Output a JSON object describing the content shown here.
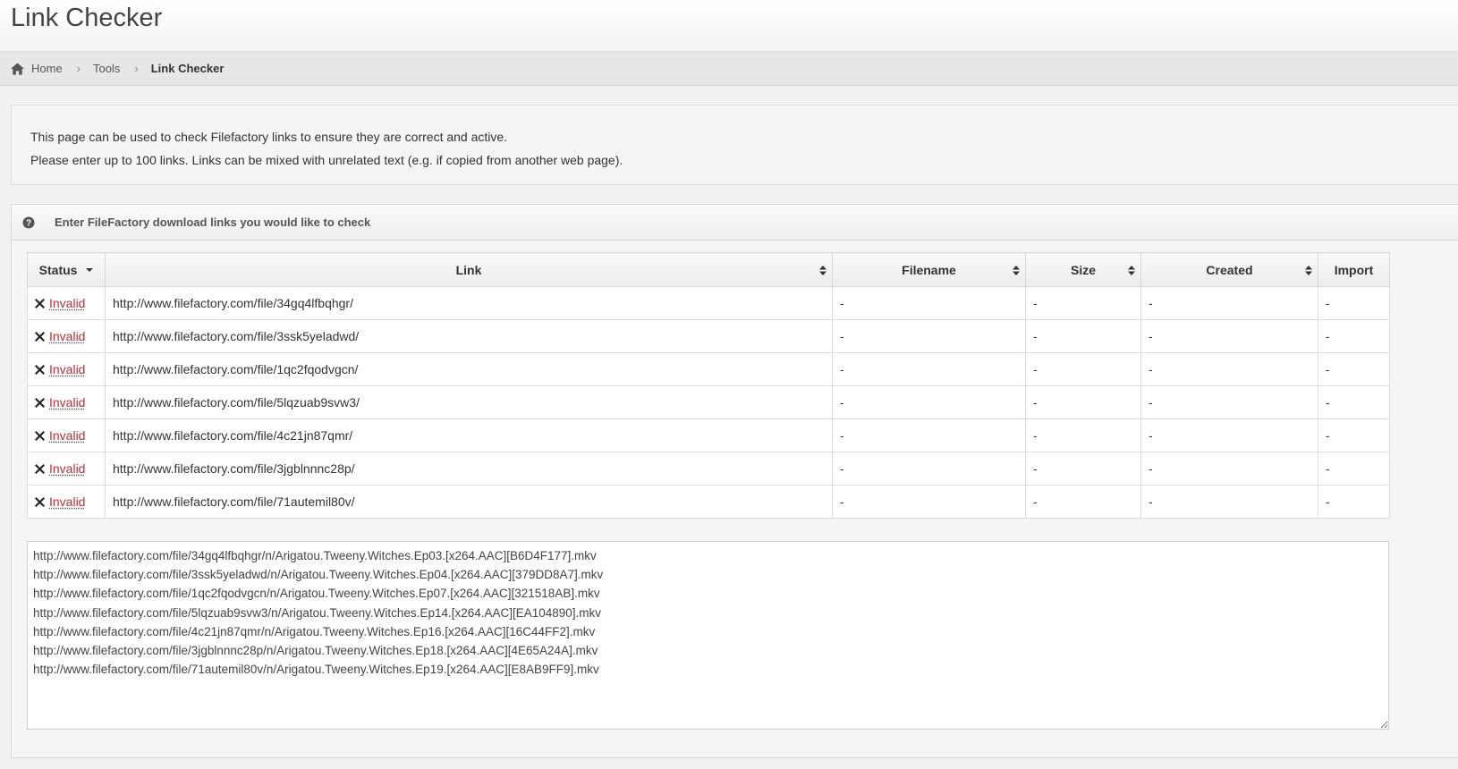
{
  "page": {
    "title": "Link Checker"
  },
  "breadcrumb": [
    {
      "label": "Home",
      "icon": "home-icon"
    },
    {
      "label": "Tools"
    },
    {
      "label": "Link Checker"
    }
  ],
  "intro": {
    "line1": "This page can be used to check Filefactory links to ensure they are correct and active.",
    "line2": "Please enter up to 100 links. Links can be mixed with unrelated text (e.g. if copied from another web page)."
  },
  "panel": {
    "title": "Enter FileFactory download links you would like to check",
    "icon": "help-circle-icon"
  },
  "table": {
    "columns": {
      "status": "Status",
      "link": "Link",
      "filename": "Filename",
      "size": "Size",
      "created": "Created",
      "import": "Import"
    },
    "rows": [
      {
        "status": "Invalid",
        "link": "http://www.filefactory.com/file/34gq4lfbqhgr/",
        "filename": "-",
        "size": "-",
        "created": "-",
        "import": "-"
      },
      {
        "status": "Invalid",
        "link": "http://www.filefactory.com/file/3ssk5yeladwd/",
        "filename": "-",
        "size": "-",
        "created": "-",
        "import": "-"
      },
      {
        "status": "Invalid",
        "link": "http://www.filefactory.com/file/1qc2fqodvgcn/",
        "filename": "-",
        "size": "-",
        "created": "-",
        "import": "-"
      },
      {
        "status": "Invalid",
        "link": "http://www.filefactory.com/file/5lqzuab9svw3/",
        "filename": "-",
        "size": "-",
        "created": "-",
        "import": "-"
      },
      {
        "status": "Invalid",
        "link": "http://www.filefactory.com/file/4c21jn87qmr/",
        "filename": "-",
        "size": "-",
        "created": "-",
        "import": "-"
      },
      {
        "status": "Invalid",
        "link": "http://www.filefactory.com/file/3jgblnnnc28p/",
        "filename": "-",
        "size": "-",
        "created": "-",
        "import": "-"
      },
      {
        "status": "Invalid",
        "link": "http://www.filefactory.com/file/71autemil80v/",
        "filename": "-",
        "size": "-",
        "created": "-",
        "import": "-"
      }
    ]
  },
  "textarea": {
    "value": "http://www.filefactory.com/file/34gq4lfbqhgr/n/Arigatou.Tweeny.Witches.Ep03.[x264.AAC][B6D4F177].mkv\nhttp://www.filefactory.com/file/3ssk5yeladwd/n/Arigatou.Tweeny.Witches.Ep04.[x264.AAC][379DD8A7].mkv\nhttp://www.filefactory.com/file/1qc2fqodvgcn/n/Arigatou.Tweeny.Witches.Ep07.[x264.AAC][321518AB].mkv\nhttp://www.filefactory.com/file/5lqzuab9svw3/n/Arigatou.Tweeny.Witches.Ep14.[x264.AAC][EA104890].mkv\nhttp://www.filefactory.com/file/4c21jn87qmr/n/Arigatou.Tweeny.Witches.Ep16.[x264.AAC][16C44FF2].mkv\nhttp://www.filefactory.com/file/3jgblnnnc28p/n/Arigatou.Tweeny.Witches.Ep18.[x264.AAC][4E65A24A].mkv\nhttp://www.filefactory.com/file/71autemil80v/n/Arigatou.Tweeny.Witches.Ep19.[x264.AAC][E8AB9FF9].mkv"
  },
  "colors": {
    "invalid": "#b5313a",
    "text": "#333333",
    "border": "#d7d7d7"
  }
}
